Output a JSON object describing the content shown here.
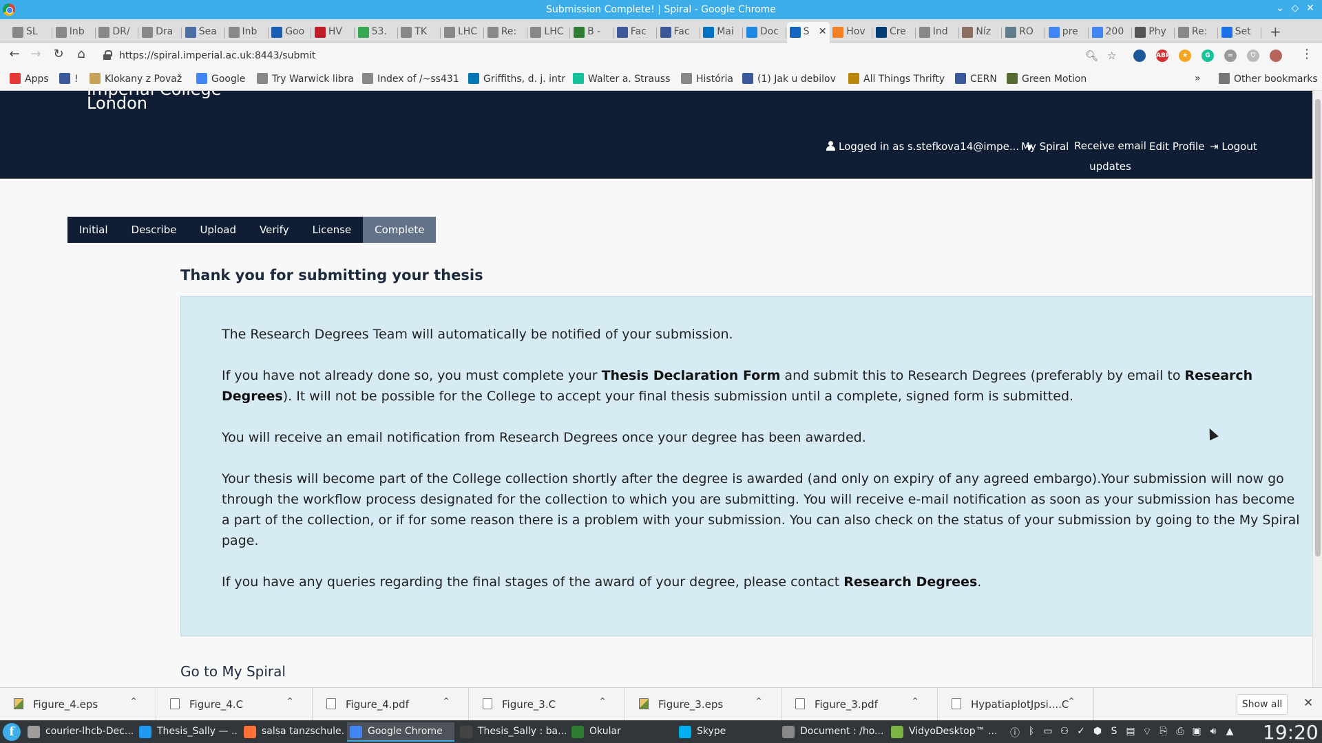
{
  "window": {
    "title": "Submission Complete! | Spiral - Google Chrome"
  },
  "tabs": [
    {
      "label": "SL",
      "icon": "doc",
      "color": "#888"
    },
    {
      "label": "Inb",
      "icon": "doc",
      "color": "#888"
    },
    {
      "label": "DR/",
      "icon": "doc",
      "color": "#888"
    },
    {
      "label": "Dra",
      "icon": "doc",
      "color": "#888"
    },
    {
      "label": "Sea",
      "icon": "cds",
      "color": "#4a6fa5"
    },
    {
      "label": "Inb",
      "icon": "doc",
      "color": "#888"
    },
    {
      "label": "Goo",
      "icon": "calendar",
      "color": "#1a5fb4"
    },
    {
      "label": "HV",
      "icon": "flag",
      "color": "#c01c28"
    },
    {
      "label": "53.",
      "icon": "maps",
      "color": "#34a853"
    },
    {
      "label": "TK",
      "icon": "doc",
      "color": "#888"
    },
    {
      "label": "LHC",
      "icon": "doc",
      "color": "#888"
    },
    {
      "label": "Re:",
      "icon": "doc",
      "color": "#888"
    },
    {
      "label": "LHC",
      "icon": "doc",
      "color": "#888"
    },
    {
      "label": "B -",
      "icon": "b",
      "color": "#2e7d32"
    },
    {
      "label": "Fac",
      "icon": "facebook",
      "color": "#3b5998"
    },
    {
      "label": "Fac",
      "icon": "facebook",
      "color": "#3b5998"
    },
    {
      "label": "Mai",
      "icon": "outlook",
      "color": "#0072c6"
    },
    {
      "label": "Doc",
      "icon": "d",
      "color": "#1e88e5"
    },
    {
      "label": "S",
      "icon": "spiral",
      "color": "#1565c0"
    },
    {
      "label": "Hov",
      "icon": "stack",
      "color": "#f48024"
    },
    {
      "label": "Cre",
      "icon": "imperial",
      "color": "#003e74"
    },
    {
      "label": "Ind",
      "icon": "doc",
      "color": "#888"
    },
    {
      "label": "Níz",
      "icon": "food",
      "color": "#8d6e63"
    },
    {
      "label": "RO",
      "icon": "note",
      "color": "#607d8b"
    },
    {
      "label": "pre",
      "icon": "google",
      "color": "#4285f4"
    },
    {
      "label": "200",
      "icon": "google",
      "color": "#4285f4"
    },
    {
      "label": "Phy",
      "icon": "folder",
      "color": "#555"
    },
    {
      "label": "Re:",
      "icon": "doc",
      "color": "#888"
    },
    {
      "label": "Set",
      "icon": "gear",
      "color": "#1a73e8"
    }
  ],
  "toolbar": {
    "url": "https://spiral.imperial.ac.uk:8443/submit",
    "extensions": [
      {
        "label": "",
        "color": "#1e5799"
      },
      {
        "label": "ABP",
        "color": "#d32f2f"
      },
      {
        "label": "★",
        "color": "#f5a623"
      },
      {
        "label": "G",
        "color": "#15c39a"
      },
      {
        "label": "∞",
        "color": "#999"
      },
      {
        "label": "⛉",
        "color": "#bbb"
      },
      {
        "label": "",
        "color": "#b5655b"
      }
    ]
  },
  "bookmarks": [
    {
      "label": "Apps",
      "icon": "apps",
      "color": "#e53935"
    },
    {
      "label": "!",
      "icon": "facebook",
      "color": "#3b5998"
    },
    {
      "label": "Klokany z Považ",
      "icon": "k",
      "color": "#c8a15a"
    },
    {
      "label": "Google",
      "icon": "google",
      "color": "#4285f4"
    },
    {
      "label": "Try Warwick libra",
      "icon": "doc",
      "color": "#888"
    },
    {
      "label": "Index of /~ss431",
      "icon": "doc",
      "color": "#888"
    },
    {
      "label": "Griffiths, d. j. intr",
      "icon": "linkedin",
      "color": "#0077b5"
    },
    {
      "label": "Walter a. Strauss",
      "icon": "grammarly",
      "color": "#15c39a"
    },
    {
      "label": "História",
      "icon": "doc",
      "color": "#888"
    },
    {
      "label": "(1) Jak u debilov",
      "icon": "facebook",
      "color": "#3b5998"
    },
    {
      "label": "All Things Thrifty",
      "icon": "hammer",
      "color": "#b8860b"
    },
    {
      "label": "CERN",
      "icon": "facebook",
      "color": "#3b5998"
    },
    {
      "label": "Green Motion",
      "icon": "car",
      "color": "#556b2f"
    }
  ],
  "bookmarks_overflow": "»",
  "other_bookmarks": "Other bookmarks",
  "site": {
    "logo_line1": "Imperial College",
    "logo_line2": "London",
    "user_label": "Logged in as s.stefkova14@impe...",
    "nav": {
      "my_spiral": "My Spiral",
      "receive_email_1": "Receive email",
      "receive_email_2": "updates",
      "edit_profile": "Edit Profile",
      "logout": "Logout"
    },
    "steps": [
      "Initial",
      "Describe",
      "Upload",
      "Verify",
      "License",
      "Complete"
    ],
    "active_step": "Complete",
    "heading": "Thank you for submitting your thesis",
    "notice": {
      "p1": "The Research Degrees Team will automatically be notified of your submission.",
      "p2_a": "If you have not already done so, you must complete your ",
      "p2_b": "Thesis Declaration Form",
      "p2_c": " and submit this to Research Degrees (preferably by email to ",
      "p2_d": "Research Degrees",
      "p2_e": "). It will not be possible for the College to accept your final thesis submission until a complete, signed form is submitted.",
      "p3": "You will receive an email notification from Research Degrees once your degree has been awarded.",
      "p4": "Your thesis will become part of the College collection shortly after the degree is awarded (and only on expiry of any agreed embargo).Your submission will now go through the workflow process designated for the collection to which you are submitting. You will receive e-mail notification as soon as your submission has become a part of the collection, or if for some reason there is a problem with your submission. You can also check on the status of your submission by going to the My Spiral page.",
      "p5_a": "If you have any queries regarding the final stages of the award of your degree, please contact ",
      "p5_b": "Research Degrees",
      "p5_c": "."
    },
    "go_link": "Go to My Spiral"
  },
  "downloads": [
    {
      "name": "Figure_4.eps",
      "type": "img"
    },
    {
      "name": "Figure_4.C",
      "type": "file"
    },
    {
      "name": "Figure_4.pdf",
      "type": "pdf"
    },
    {
      "name": "Figure_3.C",
      "type": "file"
    },
    {
      "name": "Figure_3.eps",
      "type": "img"
    },
    {
      "name": "Figure_3.pdf",
      "type": "pdf"
    },
    {
      "name": "HypatiaplotJpsi....C",
      "type": "file"
    }
  ],
  "show_all": "Show all",
  "taskbar": {
    "tasks": [
      {
        "label": "courier-lhcb-Dec...",
        "color": "#9e9e9e"
      },
      {
        "label": "Thesis_Sally — ...",
        "color": "#1d99f3"
      },
      {
        "label": "salsa tanzschule...",
        "color": "#ff7139"
      },
      {
        "label": "Google Chrome",
        "color": "#4285f4"
      },
      {
        "label": "Thesis_Sally : ba...",
        "color": "#444"
      },
      {
        "label": "Okular",
        "color": "#2e7d32"
      },
      {
        "label": "Skype",
        "color": "#00aff0"
      },
      {
        "label": "Document : /ho...",
        "color": "#888"
      },
      {
        "label": "VidyoDesktop™ ...",
        "color": "#7cb342"
      }
    ],
    "active_task": 3,
    "clock": "19:20"
  }
}
